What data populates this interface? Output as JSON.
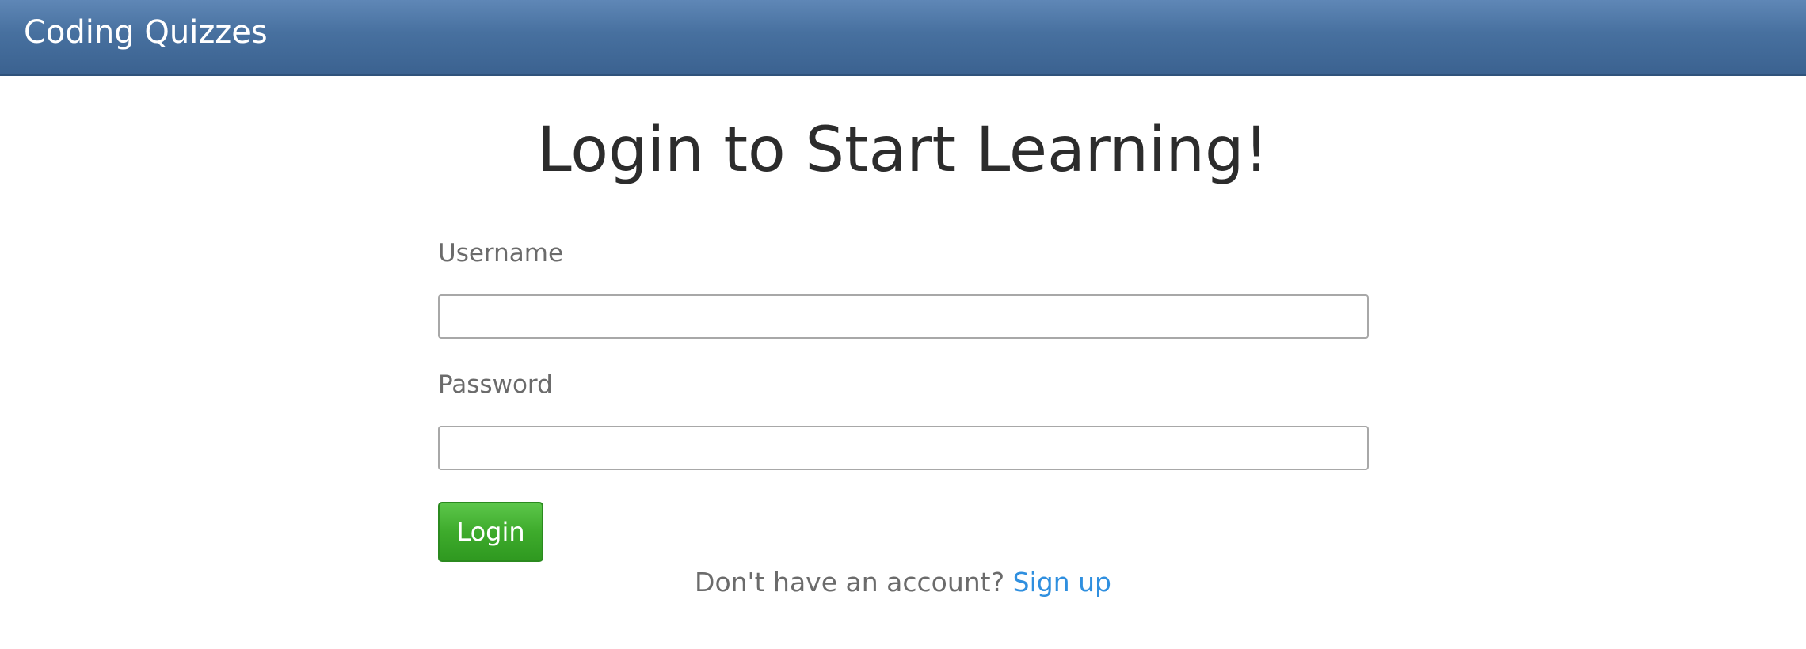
{
  "header": {
    "brand": "Coding Quizzes"
  },
  "main": {
    "title": "Login to Start Learning!",
    "form": {
      "username_label": "Username",
      "username_value": "",
      "password_label": "Password",
      "password_value": "",
      "login_button": "Login"
    },
    "signup": {
      "prompt": "Don't have an account?",
      "link": "Sign up"
    }
  },
  "colors": {
    "header_bar": "#47709f",
    "login_button": "#3eab2c",
    "link": "#2f8fdf",
    "title_text": "#2c2c2c",
    "label_text": "#6b6b6b"
  }
}
